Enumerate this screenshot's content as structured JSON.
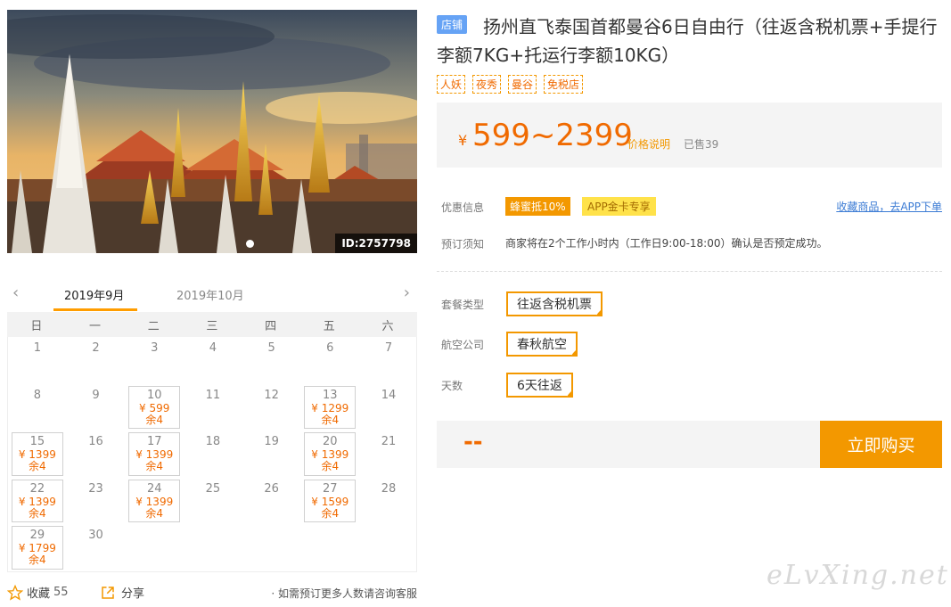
{
  "hero": {
    "id_label": "ID:2757798"
  },
  "calendar": {
    "prev_arrow": "‹",
    "next_arrow": "›",
    "months": [
      "2019年9月",
      "2019年10月"
    ],
    "weekdays": [
      "日",
      "一",
      "二",
      "三",
      "四",
      "五",
      "六"
    ],
    "cells": [
      {
        "day": "1"
      },
      {
        "day": "2"
      },
      {
        "day": "3"
      },
      {
        "day": "4"
      },
      {
        "day": "5"
      },
      {
        "day": "6"
      },
      {
        "day": "7"
      },
      {
        "day": "8"
      },
      {
        "day": "9"
      },
      {
        "day": "10",
        "price": "¥ 599",
        "left": "余4"
      },
      {
        "day": "11"
      },
      {
        "day": "12"
      },
      {
        "day": "13",
        "price": "¥ 1299",
        "left": "余4"
      },
      {
        "day": "14"
      },
      {
        "day": "15",
        "price": "¥ 1399",
        "left": "余4"
      },
      {
        "day": "16"
      },
      {
        "day": "17",
        "price": "¥ 1399",
        "left": "余4"
      },
      {
        "day": "18"
      },
      {
        "day": "19"
      },
      {
        "day": "20",
        "price": "¥ 1399",
        "left": "余4"
      },
      {
        "day": "21"
      },
      {
        "day": "22",
        "price": "¥ 1399",
        "left": "余4"
      },
      {
        "day": "23"
      },
      {
        "day": "24",
        "price": "¥ 1399",
        "left": "余4"
      },
      {
        "day": "25"
      },
      {
        "day": "26"
      },
      {
        "day": "27",
        "price": "¥ 1599",
        "left": "余4"
      },
      {
        "day": "28"
      },
      {
        "day": "29",
        "price": "¥ 1799",
        "left": "余4"
      },
      {
        "day": "30"
      }
    ]
  },
  "bottom": {
    "fav_label": "收藏",
    "fav_count": "55",
    "share_label": "分享",
    "hint": "· 如需预订更多人数请咨询客服"
  },
  "product": {
    "shop_badge": "店铺",
    "title": "扬州直飞泰国首都曼谷6日自由行（往返含税机票+手提行李额7KG+托运行李额10KG）",
    "tags": [
      "人妖",
      "夜秀",
      "曼谷",
      "免税店"
    ],
    "price_symbol": "¥",
    "price_range": "599~2399",
    "price_explain": "价格说明",
    "sold": "已售39"
  },
  "info": {
    "promo_label": "优惠信息",
    "promo_1": "蜂蜜抵10%",
    "promo_2": "APP金卡专享",
    "app_link": "收藏商品，去APP下单",
    "notice_label": "预订须知",
    "notice_text": "商家将在2个工作小时内（工作日9:00-18:00）确认是否预定成功。"
  },
  "options": {
    "package_label": "套餐类型",
    "package_value": "往返含税机票",
    "airline_label": "航空公司",
    "airline_value": "春秋航空",
    "days_label": "天数",
    "days_value": "6天往返"
  },
  "buy": {
    "total": "--",
    "button": "立即购买"
  },
  "watermark": "eLvXing.net",
  "colors": {
    "accent": "#f39800",
    "price": "#f06a00",
    "link": "#3b7bd4",
    "badge": "#66a3f5"
  }
}
